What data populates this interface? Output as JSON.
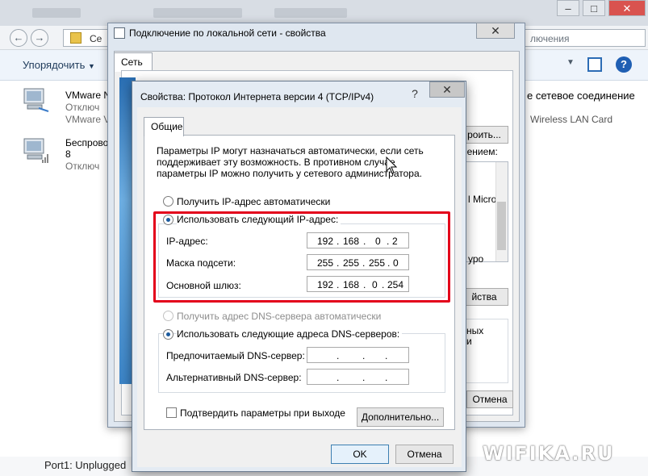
{
  "explorer": {
    "address_text": "Се",
    "search_placeholder": "лючения",
    "organize_label": "Упорядочить",
    "adapters": [
      {
        "name": "VMware N",
        "status": "Отключ",
        "device": "VMware V"
      },
      {
        "name": "Беспрово",
        "status": "8",
        "device": "Отключ"
      }
    ],
    "right_peek": {
      "connection": "е сетевое соединение",
      "device": "Wireless LAN Card",
      "configure": "роить...",
      "uses": "нением:",
      "ms_item": "l Micro",
      "level_item": "уро",
      "properties_btn": "йства",
      "desc1": "ных",
      "desc2": "и",
      "cancel_btn": "Отмена"
    },
    "status": "Port1: Unplugged",
    "watermark": "WIFIKA.RU"
  },
  "lan_dialog": {
    "title": "Подключение по локальной сети - свойства",
    "tab": "Сеть"
  },
  "ipv4": {
    "title": "Свойства: Протокол Интернета версии 4 (TCP/IPv4)",
    "help_glyph": "?",
    "close_glyph": "✕",
    "tab": "Общие",
    "description": "Параметры IP могут назначаться автоматически, если сеть поддерживает эту возможность. В противном случае параметры IP можно получить у сетевого администратора.",
    "ip_auto_label": "Получить IP-адрес автоматически",
    "ip_manual_label": "Использовать следующий IP-адрес:",
    "ip_address_label": "IP-адрес:",
    "ip_address": [
      "192",
      "168",
      "0",
      "2"
    ],
    "mask_label": "Маска подсети:",
    "mask": [
      "255",
      "255",
      "255",
      "0"
    ],
    "gateway_label": "Основной шлюз:",
    "gateway": [
      "192",
      "168",
      "0",
      "254"
    ],
    "dns_auto_label": "Получить адрес DNS-сервера автоматически",
    "dns_manual_label": "Использовать следующие адреса DNS-серверов:",
    "dns_preferred_label": "Предпочитаемый DNS-сервер:",
    "dns_alternate_label": "Альтернативный DNS-сервер:",
    "validate_label": "Подтвердить параметры при выходе",
    "advanced_btn": "Дополнительно...",
    "ok_btn": "OK",
    "cancel_btn": "Отмена"
  },
  "colors": {
    "highlight_red": "#e3001b",
    "radio_dot": "#1c5b9e"
  }
}
